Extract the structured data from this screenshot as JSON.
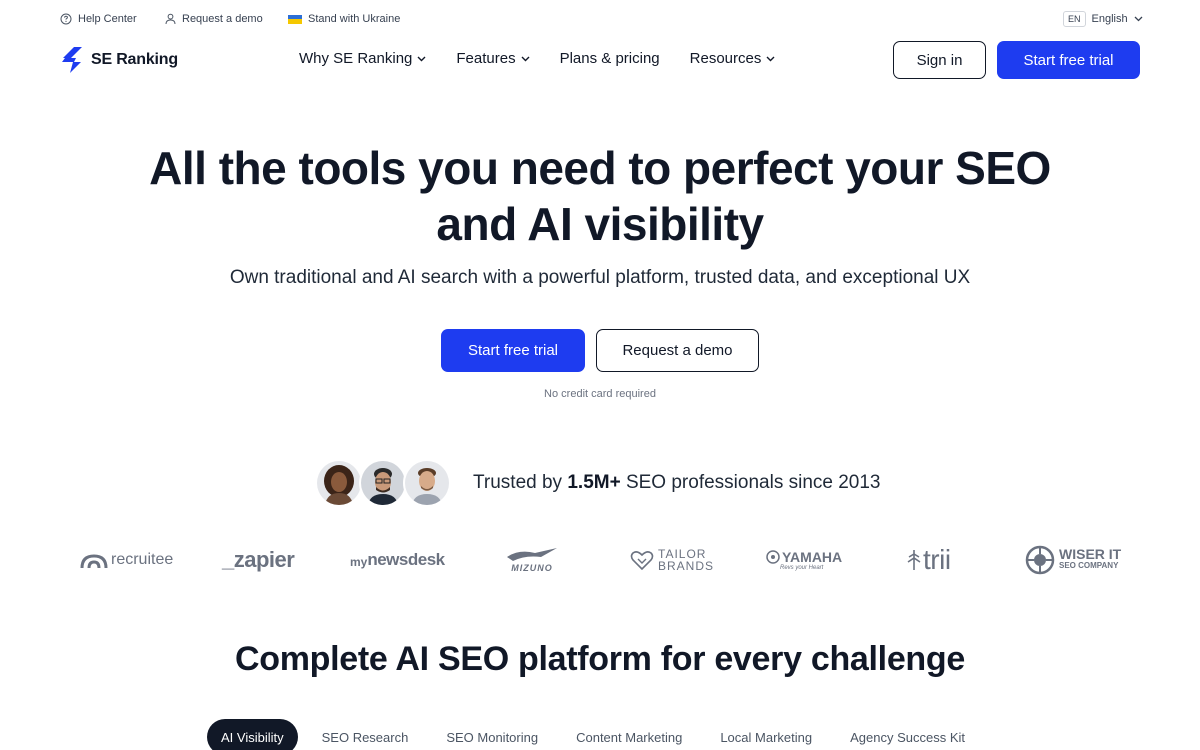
{
  "utility_bar": {
    "help_center": "Help Center",
    "request_demo": "Request a demo",
    "ukraine": "Stand with Ukraine",
    "lang_code": "EN",
    "lang_name": "English"
  },
  "brand": {
    "name": "SE Ranking",
    "color": "#1e3cf0"
  },
  "nav": {
    "items": [
      {
        "label": "Why SE Ranking",
        "has_dropdown": true
      },
      {
        "label": "Features",
        "has_dropdown": true
      },
      {
        "label": "Plans & pricing",
        "has_dropdown": false
      },
      {
        "label": "Resources",
        "has_dropdown": true
      }
    ],
    "sign_in": "Sign in",
    "start_trial": "Start free trial"
  },
  "hero": {
    "title_line1": "All the tools you need to perfect your SEO",
    "title_line2": "and AI visibility",
    "subtitle": "Own traditional and AI search with a powerful platform, trusted data, and exceptional UX",
    "cta_trial": "Start free trial",
    "cta_demo": "Request a demo",
    "note": "No credit card required"
  },
  "trust": {
    "prefix": "Trusted by ",
    "highlight": "1.5M+",
    "suffix": " SEO professionals since 2013"
  },
  "client_logos": {
    "recruitee": "recruitee",
    "zapier": "_zapier",
    "mynewsdesk_my": "my",
    "mynewsdesk_rest": "newsdesk",
    "mizuno": "MIZUNO",
    "tailor_1": "TAILOR",
    "tailor_2": "BRANDS",
    "yamaha": "YAMAHA",
    "yamaha_tag": "Revs your Heart",
    "trii": "trii",
    "wiser_1": "WISER IT",
    "wiser_2": "SEO COMPANY"
  },
  "section": {
    "title": "Complete AI SEO platform for every challenge",
    "tabs": [
      {
        "label": "AI Visibility",
        "active": true
      },
      {
        "label": "SEO Research",
        "active": false
      },
      {
        "label": "SEO Monitoring",
        "active": false
      },
      {
        "label": "Content Marketing",
        "active": false
      },
      {
        "label": "Local Marketing",
        "active": false
      },
      {
        "label": "Agency Success Kit",
        "active": false
      }
    ]
  }
}
